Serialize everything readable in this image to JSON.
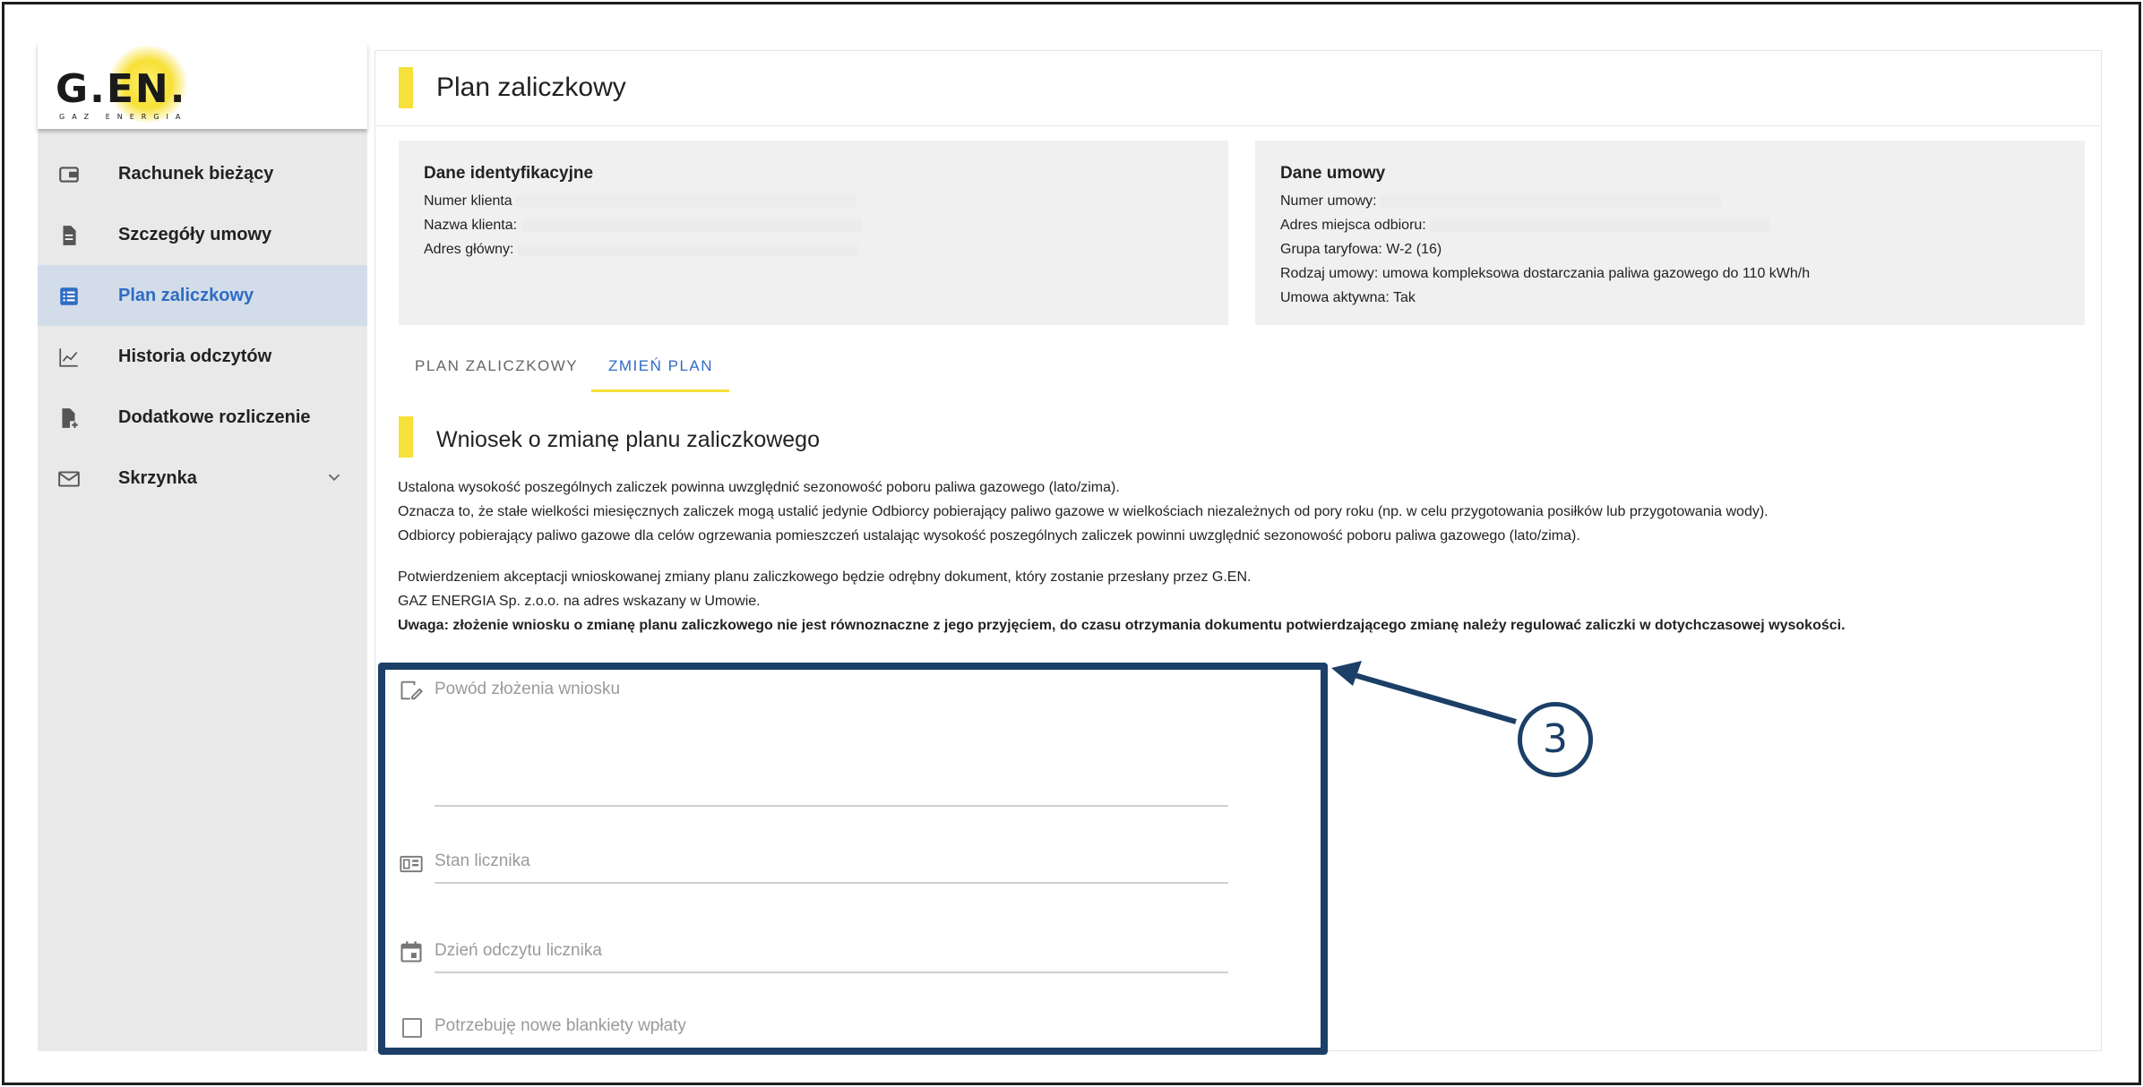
{
  "brand": {
    "logo_text": "G.EN.",
    "logo_sub": "GAZ ENERGIA"
  },
  "sidebar": {
    "items": [
      {
        "label": "Rachunek bieżący",
        "icon": "wallet-icon"
      },
      {
        "label": "Szczegóły umowy",
        "icon": "document-icon"
      },
      {
        "label": "Plan zaliczkowy",
        "icon": "list-icon",
        "active": true
      },
      {
        "label": "Historia odczytów",
        "icon": "chart-line-icon"
      },
      {
        "label": "Dodatkowe rozliczenie",
        "icon": "document-plus-icon"
      },
      {
        "label": "Skrzynka",
        "icon": "mail-icon",
        "expandable": true
      }
    ]
  },
  "header": {
    "title": "Plan zaliczkowy"
  },
  "identification": {
    "title": "Dane identyfikacyjne",
    "client_number_label": "Numer klienta",
    "client_name_label": "Nazwa klienta:",
    "main_address_label": "Adres główny:"
  },
  "contract": {
    "title": "Dane umowy",
    "contract_number_label": "Numer umowy:",
    "delivery_address_label": "Adres miejsca odbioru:",
    "tariff_group": "Grupa taryfowa: W-2 (16)",
    "contract_type_label": "Rodzaj umowy:",
    "contract_type_value": "umowa kompleksowa dostarczania paliwa gazowego do 110 kWh/h",
    "active": "Umowa aktywna: Tak"
  },
  "tabs": [
    {
      "label": "PLAN ZALICZKOWY",
      "active": false
    },
    {
      "label": "ZMIEŃ PLAN",
      "active": true
    }
  ],
  "request": {
    "title": "Wniosek o zmianę planu zaliczkowego",
    "para1": [
      "Ustalona wysokość poszególnych zaliczek powinna uwzględnić sezonowość poboru paliwa gazowego (lato/zima).",
      "Oznacza to, że stałe wielkości miesięcznych zaliczek mogą ustalić jedynie Odbiorcy pobierający paliwo gazowe w wielkościach niezależnych od pory roku (np. w celu przygotowania posiłków lub przygotowania wody).",
      "Odbiorcy pobierający paliwo gazowe dla celów ogrzewania pomieszczeń ustalając wysokość poszególnych zaliczek powinni uwzględnić sezonowość poboru paliwa gazowego (lato/zima)."
    ],
    "para2": [
      "Potwierdzeniem akceptacji wnioskowanej zmiany planu zaliczkowego będzie odrębny dokument, który zostanie przesłany przez G.EN.",
      "GAZ ENERGIA Sp. z.o.o. na adres wskazany w Umowie."
    ],
    "note": "Uwaga: złożenie wniosku o zmianę planu zaliczkowego nie jest równoznaczne z jego przyjęciem, do czasu otrzymania dokumentu potwierdzającego zmianę należy regulować zaliczki w dotychczasowej wysokości."
  },
  "form": {
    "reason_placeholder": "Powód złożenia wniosku",
    "meter_state_placeholder": "Stan licznika",
    "reading_date_placeholder": "Dzień odczytu licznika",
    "new_forms_label": "Potrzebuję nowe blankiety wpłaty",
    "new_forms_checked": false
  },
  "callout": {
    "number": "3"
  },
  "colors": {
    "accent": "#f6e03a",
    "active_blue": "#2f6cc2",
    "highlight": "#1b3f66"
  }
}
